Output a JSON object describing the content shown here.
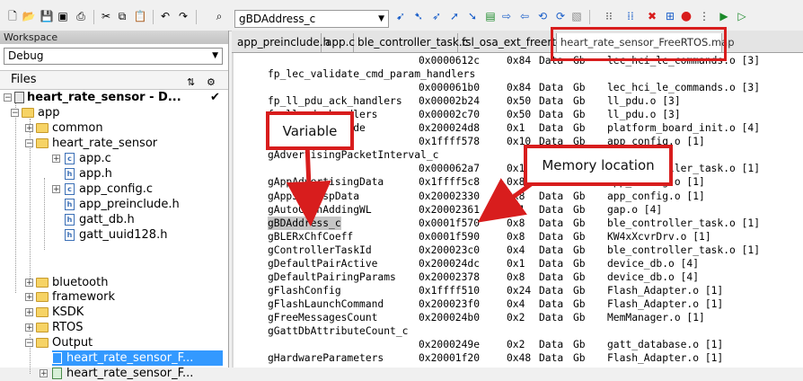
{
  "toolbar": {
    "combo_value": "gBDAddress_c",
    "icons": [
      "new-file-icon",
      "open-folder-icon",
      "save-icon",
      "save-all-icon",
      "print-icon",
      "cut-icon",
      "copy-icon",
      "paste-icon",
      "undo-icon",
      "redo-icon",
      "find-icon",
      "bookmark-icon",
      "next-bookmark-icon",
      "prev-bookmark-icon",
      "toggle-breakpoint-icon",
      "compile-icon",
      "make-icon",
      "debug-icon",
      "stop-icon"
    ]
  },
  "workspace": {
    "title": "Workspace",
    "config": "Debug",
    "files_label": "Files",
    "project": "heart_rate_sensor - D...",
    "project_check": "✔",
    "items": [
      {
        "label": "app"
      },
      {
        "label": "common"
      },
      {
        "label": "heart_rate_sensor"
      },
      {
        "label": "app.c"
      },
      {
        "label": "app.h"
      },
      {
        "label": "app_config.c"
      },
      {
        "label": "app_preinclude.h"
      },
      {
        "label": "gatt_db.h"
      },
      {
        "label": "gatt_uuid128.h"
      },
      {
        "label": "bluetooth"
      },
      {
        "label": "framework"
      },
      {
        "label": "KSDK"
      },
      {
        "label": "RTOS"
      },
      {
        "label": "Output"
      },
      {
        "label": "heart_rate_sensor_F..."
      },
      {
        "label": "heart_rate_sensor_F..."
      }
    ]
  },
  "tabs": [
    {
      "label": "app_preinclude.h"
    },
    {
      "label": "app.c"
    },
    {
      "label": "ble_controller_task.c"
    },
    {
      "label": "fsl_osa_ext_freertos.c"
    },
    {
      "label": "heart_rate_sensor_FreeRTOS.map"
    }
  ],
  "code_lines": [
    {
      "name": "",
      "addr": "0x0000612c",
      "size": "0x84",
      "kind": "Data",
      "scope": "Gb",
      "obj": "lec_hci_le_commands.o [3]"
    },
    {
      "name": "fp_lec_validate_cmd_param_handlers",
      "addr": "",
      "size": "",
      "kind": "",
      "scope": "",
      "obj": ""
    },
    {
      "name": "",
      "addr": "0x000061b0",
      "size": "0x84",
      "kind": "Data",
      "scope": "Gb",
      "obj": "lec_hci_le_commands.o [3]"
    },
    {
      "name": "fp_ll_pdu_ack_handlers",
      "addr": "0x00002b24",
      "size": "0x50",
      "kind": "Data",
      "scope": "Gb",
      "obj": "ll_pdu.o [3]"
    },
    {
      "name": "fp_ll_pdu_handlers",
      "addr": "0x00002c70",
      "size": "0x50",
      "kind": "Data",
      "scope": "Gb",
      "obj": "ll_pdu.o [3]"
    },
    {
      "name": "gAdvertisingMode",
      "addr": "0x200024d8",
      "size": "0x1",
      "kind": "Data",
      "scope": "Gb",
      "obj": "platform_board_init.o [4]"
    },
    {
      "name": "",
      "addr": "0x1ffff578",
      "size": "0x10",
      "kind": "Data",
      "scope": "Gb",
      "obj": "app_config.o [1]"
    },
    {
      "name": "gAdvertisingPacketInterval_c",
      "addr": "",
      "size": "",
      "kind": "",
      "scope": "",
      "obj": ""
    },
    {
      "name": "",
      "addr": "0x000062a7",
      "size": "0x1",
      "kind": "Data",
      "scope": "Gb",
      "obj": "ble_controller_task.o [1]"
    },
    {
      "name": "gAppAdvertisingData",
      "addr": "0x1ffff5c8",
      "size": "0x8",
      "kind": "Data",
      "scope": "Gb",
      "obj": "app_config.o [1]"
    },
    {
      "name": "gAppScanRspData",
      "addr": "0x20002330",
      "size": "0x8",
      "kind": "Data",
      "scope": "Gb",
      "obj": "app_config.o [1]"
    },
    {
      "name": "gAutoConnAddingWL",
      "addr": "0x20002361",
      "size": "0x1",
      "kind": "Data",
      "scope": "Gb",
      "obj": "gap.o [4]"
    },
    {
      "name": "gBDAddress_c",
      "addr": "0x0001f570",
      "size": "0x8",
      "kind": "Data",
      "scope": "Gb",
      "obj": "ble_controller_task.o [1]"
    },
    {
      "name": "gBLERxChfCoeff",
      "addr": "0x0001f590",
      "size": "0x8",
      "kind": "Data",
      "scope": "Gb",
      "obj": "KW4xXcvrDrv.o [1]"
    },
    {
      "name": "gControllerTaskId",
      "addr": "0x200023c0",
      "size": "0x4",
      "kind": "Data",
      "scope": "Gb",
      "obj": "ble_controller_task.o [1]"
    },
    {
      "name": "gDefaultPairActive",
      "addr": "0x200024dc",
      "size": "0x1",
      "kind": "Data",
      "scope": "Gb",
      "obj": "device_db.o [4]"
    },
    {
      "name": "gDefaultPairingParams",
      "addr": "0x20002378",
      "size": "0x8",
      "kind": "Data",
      "scope": "Gb",
      "obj": "device_db.o [4]"
    },
    {
      "name": "gFlashConfig",
      "addr": "0x1ffff510",
      "size": "0x24",
      "kind": "Data",
      "scope": "Gb",
      "obj": "Flash_Adapter.o [1]"
    },
    {
      "name": "gFlashLaunchCommand",
      "addr": "0x200023f0",
      "size": "0x4",
      "kind": "Data",
      "scope": "Gb",
      "obj": "Flash_Adapter.o [1]"
    },
    {
      "name": "gFreeMessagesCount",
      "addr": "0x200024b0",
      "size": "0x2",
      "kind": "Data",
      "scope": "Gb",
      "obj": "MemManager.o [1]"
    },
    {
      "name": "gGattDbAttributeCount_c",
      "addr": "",
      "size": "",
      "kind": "",
      "scope": "",
      "obj": ""
    },
    {
      "name": "",
      "addr": "0x2000249e",
      "size": "0x2",
      "kind": "Data",
      "scope": "Gb",
      "obj": "gatt_database.o [1]"
    },
    {
      "name": "gHardwareParameters",
      "addr": "0x20001f20",
      "size": "0x48",
      "kind": "Data",
      "scope": "Gb",
      "obj": "Flash_Adapter.o [1]"
    }
  ],
  "callouts": {
    "variable": "Variable",
    "memory": "Memory location"
  },
  "colors": {
    "accent": "#d81d1d",
    "selection": "#3399ff"
  }
}
